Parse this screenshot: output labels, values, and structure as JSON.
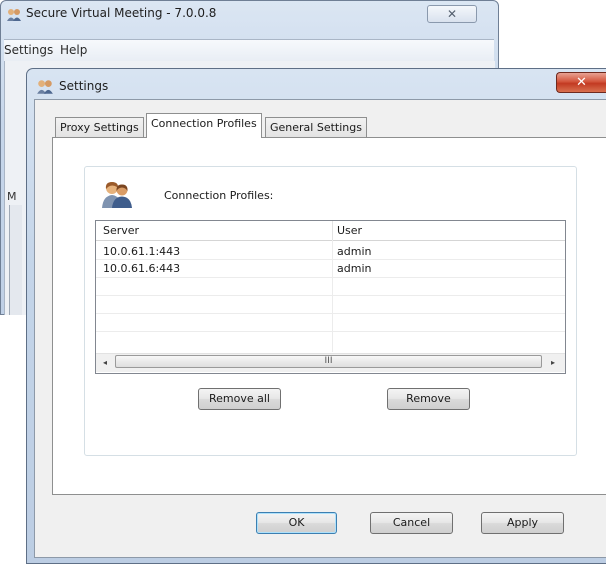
{
  "background_window": {
    "title": "Secure Virtual Meeting - 7.0.0.8",
    "close_glyph": "✕",
    "menu": [
      "Settings",
      "Help"
    ],
    "client_letter": "M"
  },
  "dialog": {
    "title": "Settings",
    "close_glyph": "✕",
    "tabs": [
      {
        "label": "Proxy Settings",
        "active": false
      },
      {
        "label": "Connection Profiles",
        "active": true
      },
      {
        "label": "General Settings",
        "active": false
      }
    ],
    "group_title": "Connection Profiles:",
    "columns": [
      "Server",
      "User"
    ],
    "rows": [
      {
        "server": "10.0.61.1:443",
        "user": "admin"
      },
      {
        "server": "10.0.61.6:443",
        "user": "admin"
      }
    ],
    "scrollbar": {
      "left_glyph": "◂",
      "thumb_glyph": "III",
      "right_glyph": "▸"
    },
    "remove_all_label": "Remove all",
    "remove_label": "Remove",
    "ok_label": "OK",
    "cancel_label": "Cancel",
    "apply_label": "Apply"
  },
  "colors": {
    "title_gradient": "#c4d5e9",
    "close_red": "#c23a22",
    "default_button_border": "#3c7fb1"
  },
  "icons": {
    "app": "users-icon",
    "group": "users-icon"
  }
}
